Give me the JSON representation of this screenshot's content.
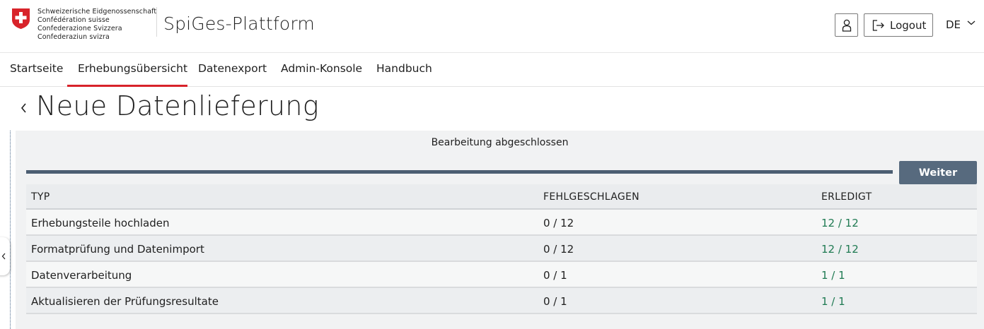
{
  "header": {
    "confederation_lines": [
      "Schweizerische Eidgenossenschaft",
      "Confédération suisse",
      "Confederazione Svizzera",
      "Confederaziun svizra"
    ],
    "app_title": "SpiGes-Plattform",
    "logout_label": "Logout",
    "language": "DE"
  },
  "nav": {
    "items": [
      "Startseite",
      "Erhebungsübersicht",
      "Datenexport",
      "Admin-Konsole",
      "Handbuch"
    ],
    "active_index": 1
  },
  "page": {
    "title": "Neue Datenlieferung"
  },
  "panel": {
    "status_text": "Bearbeitung abgeschlossen",
    "progress": 1.0,
    "weiter_label": "Weiter"
  },
  "table": {
    "columns": [
      "TYP",
      "FEHLGESCHLAGEN",
      "ERLEDIGT"
    ],
    "rows": [
      {
        "typ": "Erhebungsteile hochladen",
        "fehlgeschlagen": "0 / 12",
        "erledigt": "12 / 12"
      },
      {
        "typ": "Formatprüfung und Datenimport",
        "fehlgeschlagen": "0 / 12",
        "erledigt": "12 / 12"
      },
      {
        "typ": "Datenverarbeitung",
        "fehlgeschlagen": "0 / 1",
        "erledigt": "1 / 1"
      },
      {
        "typ": "Aktualisieren der Prüfungsresultate",
        "fehlgeschlagen": "0 / 1",
        "erledigt": "1 / 1"
      }
    ]
  },
  "colors": {
    "accent_red": "#d8232a",
    "progress": "#4c5e72",
    "button": "#576a7e",
    "success_green": "#1f7a52"
  },
  "icons": {
    "flag": "swiss-flag-icon",
    "user": "user-icon",
    "logout": "logout-icon",
    "language_chevron": "chevron-down-icon",
    "back": "chevron-left-icon",
    "side_handle": "chevron-left-icon"
  }
}
